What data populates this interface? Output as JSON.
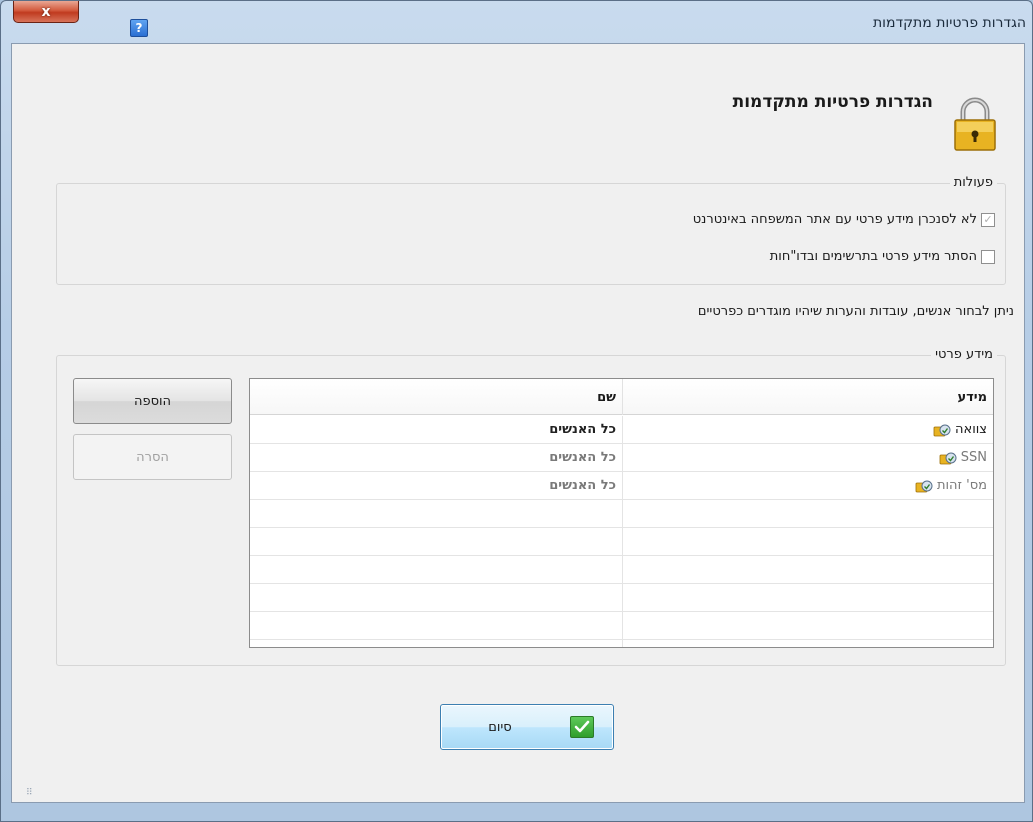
{
  "window": {
    "title": "הגדרות פרטיות מתקדמות",
    "close_label": "x",
    "help_label": "?"
  },
  "header": {
    "title": "הגדרות פרטיות מתקדמות",
    "icon": "lock-icon"
  },
  "actions_group": {
    "label": "פעולות",
    "options": [
      {
        "label": "לא לסנכרן מידע פרטי עם אתר המשפחה באינטרנט",
        "checked": true,
        "enabled": false
      },
      {
        "label": "הסתר מידע פרטי בתרשימים ובדו\"חות",
        "checked": false,
        "enabled": true
      }
    ]
  },
  "info_text": "ניתן לבחור אנשים, עובדות והערות שיהיו מוגדרים כפרטיים",
  "private_group": {
    "label": "מידע פרטי",
    "columns": {
      "info": "מידע",
      "name": "שם"
    },
    "rows": [
      {
        "info": "צוואה",
        "name": "כל האנשים",
        "icon": "private-fact-icon"
      },
      {
        "info": "SSN",
        "name": "כל האנשים",
        "icon": "private-fact-icon"
      },
      {
        "info": "מס' זהות",
        "name": "כל האנשים",
        "icon": "private-fact-icon"
      }
    ],
    "add_button": "הוספה",
    "remove_button": "הסרה"
  },
  "footer": {
    "finish_button": "סיום"
  },
  "colors": {
    "window_frame": "#b6cde6",
    "client_bg": "#f0f0f0",
    "finish_button": "#bee6fd",
    "check_green": "#2f9e2c",
    "close_red": "#c03a1f"
  }
}
